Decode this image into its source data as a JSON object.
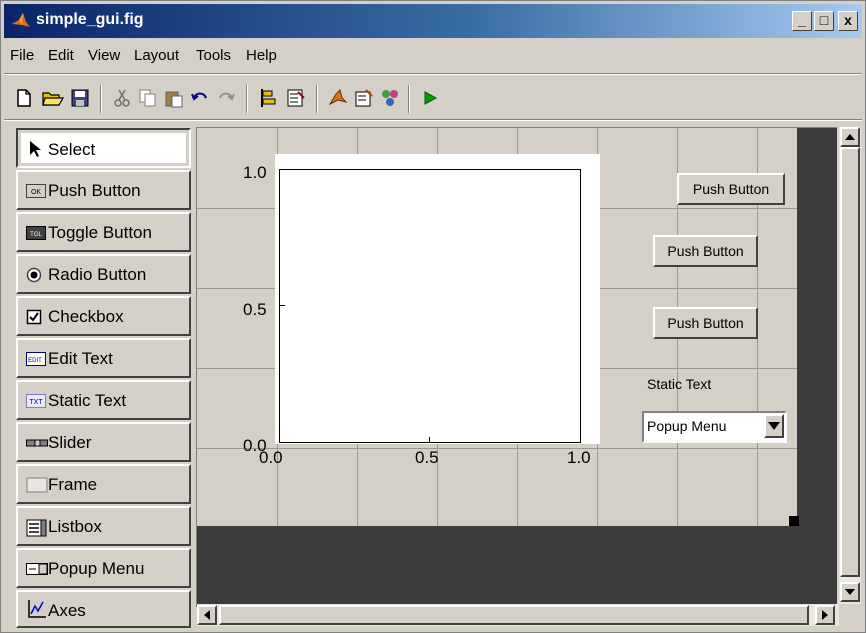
{
  "window": {
    "title": "simple_gui.fig",
    "controls": [
      "_",
      "□",
      "x"
    ]
  },
  "menu": {
    "items": [
      "File",
      "Edit",
      "View",
      "Layout",
      "Tools",
      "Help"
    ]
  },
  "toolbar": {
    "icons": [
      "new-icon",
      "open-icon",
      "save-icon",
      "cut-icon",
      "copy-icon",
      "paste-icon",
      "undo-icon",
      "redo-icon",
      "align-icon",
      "property-inspector-icon",
      "menu-editor-icon",
      "tab-order-icon",
      "object-browser-icon",
      "run-icon"
    ]
  },
  "palette": {
    "items": [
      {
        "label": "Select",
        "icon": "arrow-icon",
        "selected": true
      },
      {
        "label": "Push Button",
        "icon": "push-button-icon",
        "badge": "OK"
      },
      {
        "label": "Toggle Button",
        "icon": "toggle-button-icon",
        "badge": "TGL"
      },
      {
        "label": "Radio Button",
        "icon": "radio-button-icon"
      },
      {
        "label": "Checkbox",
        "icon": "checkbox-icon"
      },
      {
        "label": "Edit Text",
        "icon": "edit-text-icon",
        "badge": "EDIT"
      },
      {
        "label": "Static Text",
        "icon": "static-text-icon",
        "badge": "TXT"
      },
      {
        "label": "Slider",
        "icon": "slider-icon"
      },
      {
        "label": "Frame",
        "icon": "frame-icon"
      },
      {
        "label": "Listbox",
        "icon": "listbox-icon"
      },
      {
        "label": "Popup Menu",
        "icon": "popup-menu-icon"
      },
      {
        "label": "Axes",
        "icon": "axes-icon"
      }
    ]
  },
  "layout": {
    "axes": {
      "x_ticks": [
        "0.0",
        "0.5",
        "1.0"
      ],
      "y_ticks": [
        "1.0",
        "0.5",
        "0.0"
      ]
    },
    "push_buttons": [
      "Push Button",
      "Push Button",
      "Push Button"
    ],
    "static_text": "Static Text",
    "popup_menu": "Popup Menu"
  },
  "colors": {
    "title_start": "#0a246a",
    "title_end": "#a6caf0",
    "chrome": "#d4d0c8",
    "canvas_bg": "#3c3c3c",
    "grid": "#9a9690",
    "run_green": "#00a000"
  }
}
